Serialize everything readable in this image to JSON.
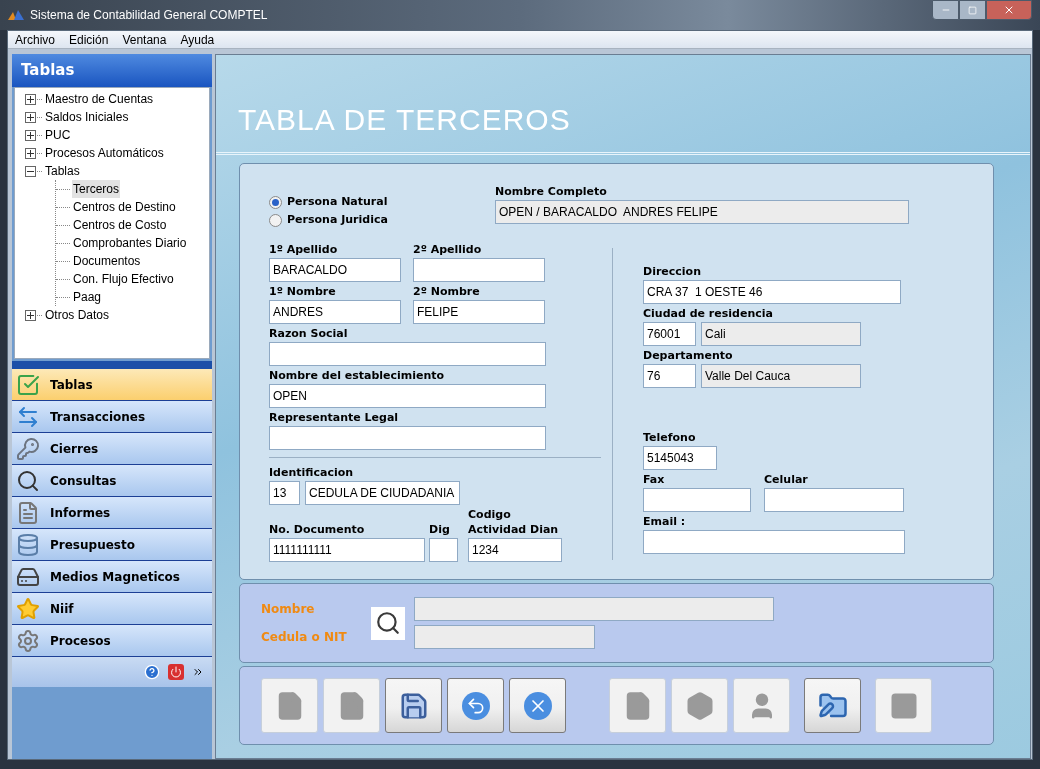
{
  "window": {
    "title": "Sistema de Contabilidad General COMPTEL"
  },
  "menu": [
    "Archivo",
    "Edición",
    "Ventana",
    "Ayuda"
  ],
  "sidebar": {
    "title": "Tablas",
    "tree": [
      {
        "label": "Maestro de Cuentas",
        "expanded": false,
        "selected": false
      },
      {
        "label": "Saldos Iniciales",
        "expanded": false,
        "selected": false
      },
      {
        "label": "PUC",
        "expanded": false,
        "selected": false
      },
      {
        "label": "Procesos Automáticos",
        "expanded": false,
        "selected": false
      },
      {
        "label": "Tablas",
        "expanded": true,
        "selected": false,
        "children": [
          {
            "label": "Terceros",
            "selected": true
          },
          {
            "label": "Centros de Destino",
            "selected": false
          },
          {
            "label": "Centros de Costo",
            "selected": false
          },
          {
            "label": "Comprobantes Diario",
            "selected": false
          },
          {
            "label": "Documentos",
            "selected": false
          },
          {
            "label": "Con. Flujo Efectivo",
            "selected": false
          },
          {
            "label": "Paag",
            "selected": false
          }
        ]
      },
      {
        "label": "Otros Datos",
        "expanded": false,
        "selected": false
      }
    ],
    "nav": [
      {
        "label": "Tablas",
        "selected": true
      },
      {
        "label": "Transacciones",
        "selected": false
      },
      {
        "label": "Cierres",
        "selected": false
      },
      {
        "label": "Consultas",
        "selected": false
      },
      {
        "label": "Informes",
        "selected": false
      },
      {
        "label": "Presupuesto",
        "selected": false
      },
      {
        "label": "Medios Magneticos",
        "selected": false
      },
      {
        "label": "Niif",
        "selected": false
      },
      {
        "label": "Procesos",
        "selected": false
      }
    ]
  },
  "page_title": "TABLA DE TERCEROS",
  "person_type": [
    {
      "label": "Persona Natural",
      "selected": true
    },
    {
      "label": "Persona Juridica",
      "selected": false
    }
  ],
  "form": {
    "nombre_completo": {
      "label": "Nombre Completo",
      "inputs": [
        {
          "value": "OPEN / BARACALDO  ANDRES FELIPE",
          "readonly": true
        }
      ]
    },
    "apellido_1": {
      "label": "1º Apellido",
      "inputs": [
        {
          "value": "BARACALDO",
          "readonly": false
        }
      ]
    },
    "apellido_2": {
      "label": "2º Apellido",
      "inputs": [
        {
          "readonly": false
        }
      ]
    },
    "nombre_1": {
      "label": "1º Nombre",
      "inputs": [
        {
          "value": "ANDRES",
          "readonly": false
        }
      ]
    },
    "nombre_2": {
      "label": "2º Nombre",
      "inputs": [
        {
          "value": "FELIPE",
          "readonly": false
        }
      ]
    },
    "razon_social": {
      "label": "Razon Social",
      "inputs": [
        {
          "readonly": false
        }
      ]
    },
    "establecimiento": {
      "label": "Nombre del establecimiento",
      "inputs": [
        {
          "value": "OPEN",
          "readonly": false
        }
      ]
    },
    "representante": {
      "label": "Representante Legal",
      "inputs": [
        {
          "readonly": false
        }
      ]
    },
    "identificacion": {
      "label": "Identificacion",
      "inputs": [
        {
          "value": "13",
          "readonly": false
        },
        {
          "value": "CEDULA DE CIUDADANIA",
          "readonly": false
        }
      ]
    },
    "documento": {
      "label": "No. Documento",
      "inputs": [
        {
          "value": "1111111111",
          "readonly": false
        }
      ]
    },
    "dig": {
      "label": "Dig",
      "inputs": [
        {
          "readonly": false
        }
      ]
    },
    "actividad": {
      "label": "Codigo Actividad Dian",
      "inputs": [
        {
          "value": "1234",
          "readonly": false
        }
      ]
    },
    "direccion": {
      "label": "Direccion",
      "inputs": [
        {
          "value": "CRA 37  1 OESTE 46",
          "readonly": false
        }
      ]
    },
    "ciudad": {
      "label": "Ciudad de residencia",
      "inputs": [
        {
          "value": "76001",
          "readonly": false
        },
        {
          "value": "Cali",
          "readonly": true
        }
      ]
    },
    "departamento": {
      "label": "Departamento",
      "inputs": [
        {
          "value": "76",
          "readonly": false
        },
        {
          "value": "Valle Del Cauca",
          "readonly": true
        }
      ]
    },
    "telefono": {
      "label": "Telefono",
      "inputs": [
        {
          "value": "5145043",
          "readonly": false
        }
      ]
    },
    "fax": {
      "label": "Fax",
      "inputs": [
        {
          "readonly": false
        }
      ]
    },
    "celular": {
      "label": "Celular",
      "inputs": [
        {
          "readonly": false
        }
      ]
    },
    "email": {
      "label": "Email :",
      "inputs": [
        {
          "readonly": false
        }
      ]
    }
  },
  "search": [
    {
      "label": "Nombre",
      "readonly": true
    },
    {
      "label": "Cedula o NIT",
      "readonly": true
    }
  ],
  "toolbar": [
    {
      "kind": "new",
      "disabled": true
    },
    {
      "kind": "edit",
      "disabled": true
    },
    {
      "kind": "save",
      "disabled": false
    },
    {
      "kind": "undo",
      "disabled": false
    },
    {
      "kind": "cancel",
      "disabled": false
    },
    {
      "kind": "document",
      "disabled": true
    },
    {
      "kind": "shape",
      "disabled": true
    },
    {
      "kind": "person",
      "disabled": true
    },
    {
      "kind": "folder",
      "disabled": false
    },
    {
      "kind": "square",
      "disabled": true
    }
  ]
}
